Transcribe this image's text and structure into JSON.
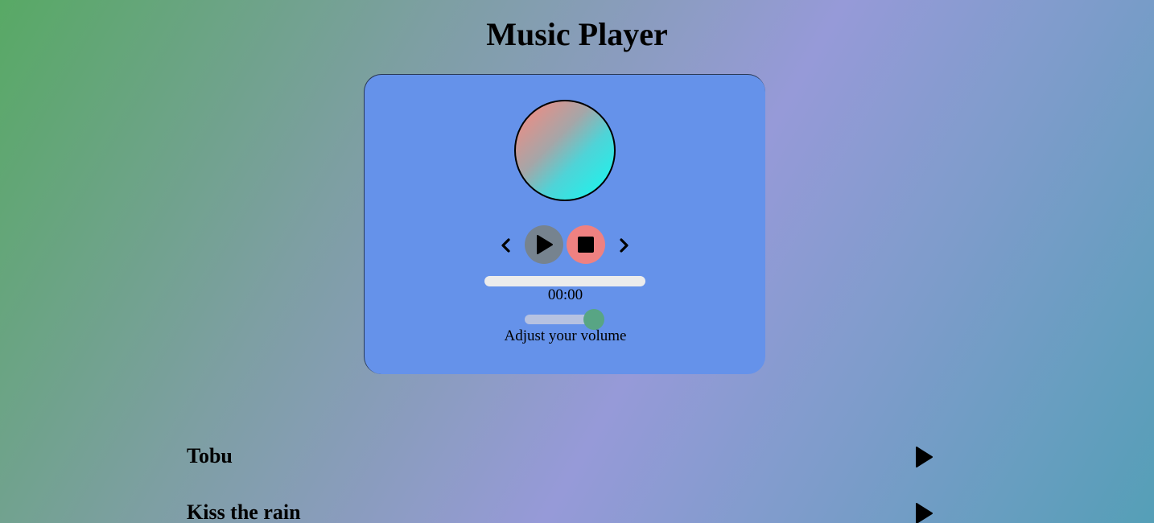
{
  "header": {
    "title": "Music Player"
  },
  "player": {
    "controls": {
      "prev_icon": "chevron-left-icon",
      "play_icon": "play-icon",
      "stop_icon": "stop-icon",
      "next_icon": "chevron-right-icon"
    },
    "progress": {
      "value": 0
    },
    "time": "00:00",
    "volume": {
      "value": 0.9,
      "label": "Adjust your volume"
    }
  },
  "playlist": {
    "items": [
      {
        "title": "Tobu",
        "play_icon": "play-icon"
      },
      {
        "title": "Kiss the rain",
        "play_icon": "play-icon"
      }
    ]
  },
  "colors": {
    "card": "#6592ea",
    "play_button": "#76838f",
    "stop_button": "#ef8181",
    "progress_track": "#ececec",
    "volume_track": "#b6c2e1",
    "volume_thumb": "#58a584"
  }
}
